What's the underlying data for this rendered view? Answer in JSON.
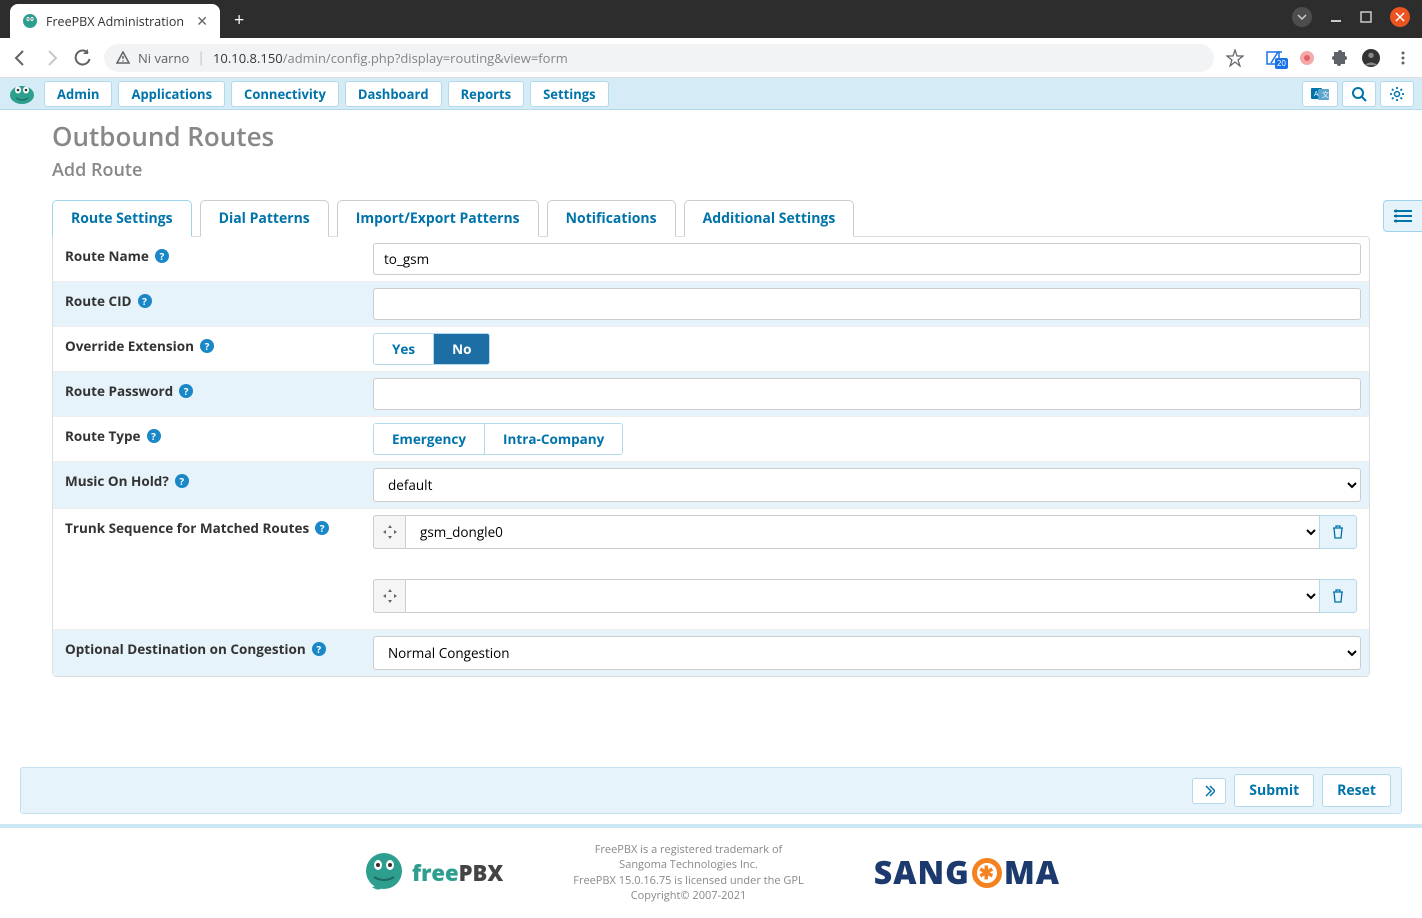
{
  "browser": {
    "tab_title": "FreePBX Administration",
    "security_label": "Ni varno",
    "url_host": "10.10.8.150",
    "url_path": "/admin/config.php?display=routing&view=form",
    "ext_badge": "20"
  },
  "nav": {
    "items": [
      "Admin",
      "Applications",
      "Connectivity",
      "Dashboard",
      "Reports",
      "Settings"
    ]
  },
  "page": {
    "title": "Outbound Routes",
    "subtitle": "Add Route"
  },
  "tabs": [
    "Route Settings",
    "Dial Patterns",
    "Import/Export Patterns",
    "Notifications",
    "Additional Settings"
  ],
  "form": {
    "route_name": {
      "label": "Route Name",
      "value": "to_gsm"
    },
    "route_cid": {
      "label": "Route CID",
      "value": ""
    },
    "override_ext": {
      "label": "Override Extension",
      "yes": "Yes",
      "no": "No"
    },
    "route_password": {
      "label": "Route Password",
      "value": ""
    },
    "route_type": {
      "label": "Route Type",
      "emergency": "Emergency",
      "intra": "Intra-Company"
    },
    "music_on_hold": {
      "label": "Music On Hold?",
      "value": "default"
    },
    "trunk_seq": {
      "label": "Trunk Sequence for Matched Routes",
      "rows": [
        "gsm_dongle0",
        ""
      ]
    },
    "congestion": {
      "label": "Optional Destination on Congestion",
      "value": "Normal Congestion"
    }
  },
  "actions": {
    "submit": "Submit",
    "reset": "Reset"
  },
  "footer": {
    "line1": "FreePBX is a registered trademark of",
    "line2": "Sangoma Technologies Inc.",
    "line3": "FreePBX 15.0.16.75 is licensed under the GPL",
    "line4": "Copyright© 2007-2021",
    "fpbx_brand_free": "free",
    "fpbx_brand_pbx": "PBX"
  }
}
